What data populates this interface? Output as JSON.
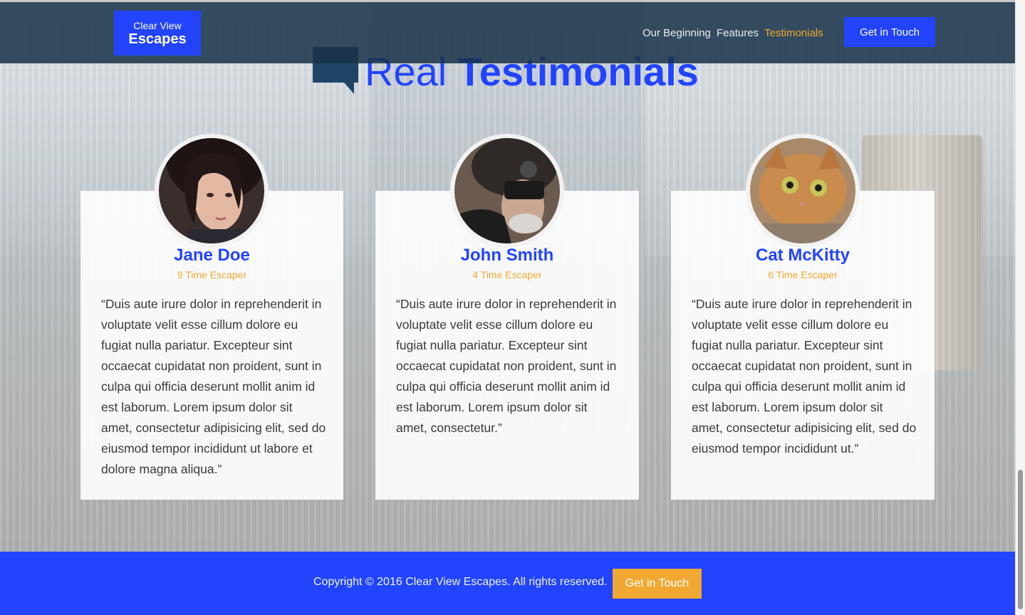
{
  "brand": {
    "line1": "Clear View",
    "line2": "Escapes"
  },
  "nav": {
    "items": [
      {
        "label": "Our Beginning",
        "active": false
      },
      {
        "label": "Features",
        "active": false
      },
      {
        "label": "Testimonials",
        "active": true
      }
    ],
    "cta_label": "Get in Touch"
  },
  "section": {
    "title_light": "Real",
    "title_bold": "Testimonials"
  },
  "testimonials": [
    {
      "name": "Jane Doe",
      "subtitle": "9 Time Escaper",
      "quote": "“Duis aute irure dolor in reprehenderit in voluptate velit esse cillum dolore eu fugiat nulla pariatur. Excepteur sint occaecat cupidatat non proident, sunt in culpa qui officia deserunt mollit anim id est laborum. Lorem ipsum dolor sit amet, consectetur adipisicing elit, sed do eiusmod tempor incididunt ut labore et dolore magna aliqua.”"
    },
    {
      "name": "John Smith",
      "subtitle": "4 Time Escaper",
      "quote": "“Duis aute irure dolor in reprehenderit in voluptate velit esse cillum dolore eu fugiat nulla pariatur. Excepteur sint occaecat cupidatat non proident, sunt in culpa qui officia deserunt mollit anim id est laborum. Lorem ipsum dolor sit amet, consectetur.”"
    },
    {
      "name": "Cat McKitty",
      "subtitle": "6 Time Escaper",
      "quote": "“Duis aute irure dolor in reprehenderit in voluptate velit esse cillum dolore eu fugiat nulla pariatur. Excepteur sint occaecat cupidatat non proident, sunt in culpa qui officia deserunt mollit anim id est laborum. Lorem ipsum dolor sit amet, consectetur adipisicing elit, sed do eiusmod tempor incididunt ut.”"
    }
  ],
  "footer": {
    "copyright": "Copyright © 2016 Clear View Escapes. All rights reserved.",
    "cta_label": "Get in Touch"
  },
  "colors": {
    "brand_blue": "#2244ff",
    "accent_orange": "#f0a832",
    "navbar": "#183248"
  },
  "icons": [
    "speech-bubble-icon"
  ]
}
